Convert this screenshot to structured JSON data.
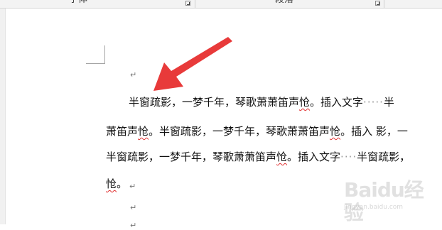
{
  "ribbon": {
    "group_font": "字体",
    "group_paragraph": "段落"
  },
  "document": {
    "lines": [
      {
        "segments": [
          {
            "text": "半窗疏影，一梦千年，琴歌萧萧笛声"
          },
          {
            "text": "怆",
            "spell": true
          },
          {
            "text": "。插入文字"
          },
          {
            "text": "·····",
            "dots": true
          },
          {
            "text": "半"
          }
        ]
      },
      {
        "segments": [
          {
            "text": "萧笛声"
          },
          {
            "text": "怆",
            "spell": true
          },
          {
            "text": "。半窗疏影，一梦千年，琴歌萧萧笛声"
          },
          {
            "text": "怆",
            "spell": true
          },
          {
            "text": "。插入 影，一"
          }
        ]
      },
      {
        "segments": [
          {
            "text": "半窗疏影，一梦千年，琴歌萧萧笛声"
          },
          {
            "text": "怆",
            "spell": true
          },
          {
            "text": "。插入文字"
          },
          {
            "text": "····",
            "dots": true
          },
          {
            "text": "半窗疏影，"
          }
        ]
      },
      {
        "segments": [
          {
            "text": "怆",
            "spell": true
          },
          {
            "text": "。"
          }
        ]
      }
    ],
    "paragraph_mark": "↵"
  },
  "watermark": {
    "brand": "Baidu经验",
    "url": "jingyan.baidu.com"
  },
  "colors": {
    "arrow": "#e83a3a",
    "spell_underline": "#e03030"
  }
}
